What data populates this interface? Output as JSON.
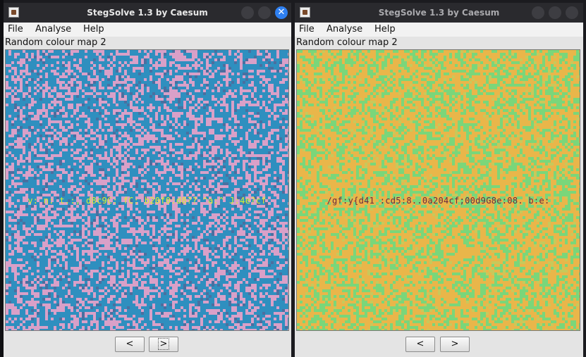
{
  "windows": [
    {
      "title": "StegSolve 1.3 by Caesum",
      "menu": [
        "File",
        "Analyse",
        "Help"
      ],
      "map_label": "Random colour map 2",
      "hidden_text": "v: n: t.:, d8c9C: fC: b20f0:d8?? ^a:^  J:4e?cf",
      "prev_label": "<",
      "next_label": ">",
      "colors": {
        "a": "#2f8fbf",
        "b": "#d9a0c8",
        "c": "#4a6fa0"
      }
    },
    {
      "title": "StegSolve 1.3 by Caesum",
      "menu": [
        "File",
        "Analyse",
        "Help"
      ],
      "map_label": "Random colour map 2",
      "hidden_text": "/gf:y{d41  :cd5:8..0a204cf;00d9G8e:08. b:e:",
      "prev_label": "<",
      "next_label": ">",
      "colors": {
        "a": "#e9b64a",
        "b": "#7ad67a",
        "c": "#c9c85a"
      }
    }
  ]
}
